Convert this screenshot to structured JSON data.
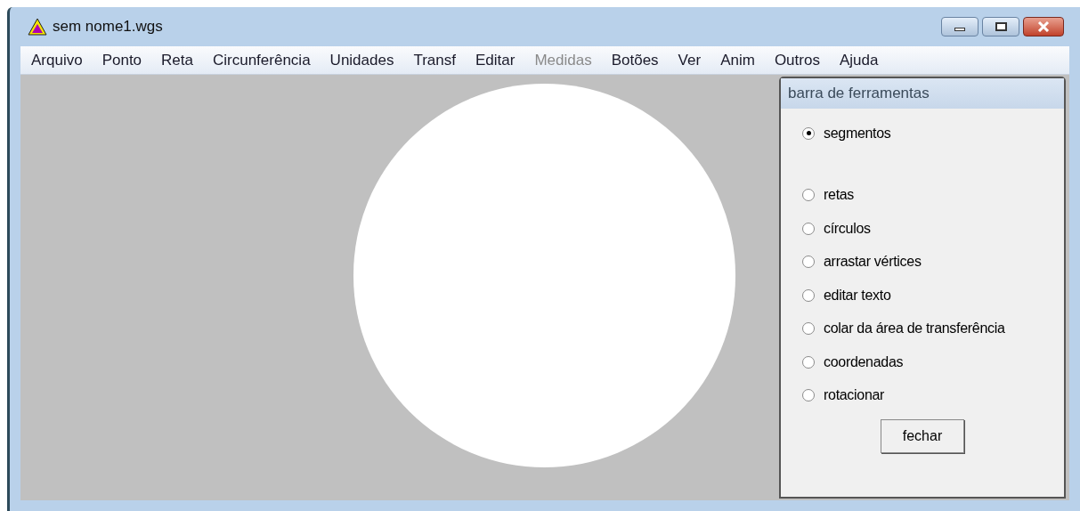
{
  "window": {
    "title": "sem nome1.wgs"
  },
  "menu": [
    {
      "label": "Arquivo",
      "disabled": false
    },
    {
      "label": "Ponto",
      "disabled": false
    },
    {
      "label": "Reta",
      "disabled": false
    },
    {
      "label": "Circunferência",
      "disabled": false
    },
    {
      "label": "Unidades",
      "disabled": false
    },
    {
      "label": "Transf",
      "disabled": false
    },
    {
      "label": "Editar",
      "disabled": false
    },
    {
      "label": "Medidas",
      "disabled": true
    },
    {
      "label": "Botões",
      "disabled": false
    },
    {
      "label": "Ver",
      "disabled": false
    },
    {
      "label": "Anim",
      "disabled": false
    },
    {
      "label": "Outros",
      "disabled": false
    },
    {
      "label": "Ajuda",
      "disabled": false
    }
  ],
  "toolbar_panel": {
    "title": "barra de ferramentas",
    "options": [
      {
        "label": "segmentos",
        "selected": true
      },
      {
        "label": "retas",
        "selected": false
      },
      {
        "label": "círculos",
        "selected": false
      },
      {
        "label": "arrastar vértices",
        "selected": false
      },
      {
        "label": "editar texto",
        "selected": false
      },
      {
        "label": "colar da área de transferência",
        "selected": false
      },
      {
        "label": "coordenadas",
        "selected": false
      },
      {
        "label": "rotacionar",
        "selected": false
      }
    ],
    "button": "fechar"
  }
}
